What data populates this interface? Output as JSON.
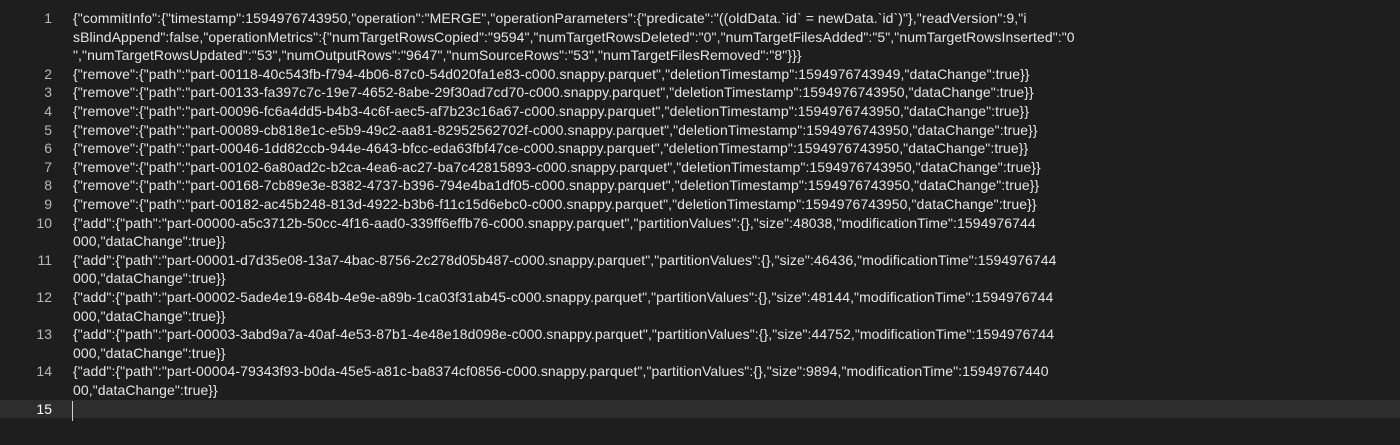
{
  "editor": {
    "lines": [
      {
        "number": "1",
        "text": [
          "{\"commitInfo\":{\"timestamp\":1594976743950,\"operation\":\"MERGE\",\"operationParameters\":{\"predicate\":\"((oldData.`id` = newData.`id`)\"},\"readVersion\":9,\"i",
          "sBlindAppend\":false,\"operationMetrics\":{\"numTargetRowsCopied\":\"9594\",\"numTargetRowsDeleted\":\"0\",\"numTargetFilesAdded\":\"5\",\"numTargetRowsInserted\":\"0",
          "\",\"numTargetRowsUpdated\":\"53\",\"numOutputRows\":\"9647\",\"numSourceRows\":\"53\",\"numTargetFilesRemoved\":\"8\"}}}"
        ]
      },
      {
        "number": "2",
        "text": [
          "{\"remove\":{\"path\":\"part-00118-40c543fb-f794-4b06-87c0-54d020fa1e83-c000.snappy.parquet\",\"deletionTimestamp\":1594976743949,\"dataChange\":true}}"
        ]
      },
      {
        "number": "3",
        "text": [
          "{\"remove\":{\"path\":\"part-00133-fa397c7c-19e7-4652-8abe-29f30ad7cd70-c000.snappy.parquet\",\"deletionTimestamp\":1594976743950,\"dataChange\":true}}"
        ]
      },
      {
        "number": "4",
        "text": [
          "{\"remove\":{\"path\":\"part-00096-fc6a4dd5-b4b3-4c6f-aec5-af7b23c16a67-c000.snappy.parquet\",\"deletionTimestamp\":1594976743950,\"dataChange\":true}}"
        ]
      },
      {
        "number": "5",
        "text": [
          "{\"remove\":{\"path\":\"part-00089-cb818e1c-e5b9-49c2-aa81-82952562702f-c000.snappy.parquet\",\"deletionTimestamp\":1594976743950,\"dataChange\":true}}"
        ]
      },
      {
        "number": "6",
        "text": [
          "{\"remove\":{\"path\":\"part-00046-1dd82ccb-944e-4643-bfcc-eda63fbf47ce-c000.snappy.parquet\",\"deletionTimestamp\":1594976743950,\"dataChange\":true}}"
        ]
      },
      {
        "number": "7",
        "text": [
          "{\"remove\":{\"path\":\"part-00102-6a80ad2c-b2ca-4ea6-ac27-ba7c42815893-c000.snappy.parquet\",\"deletionTimestamp\":1594976743950,\"dataChange\":true}}"
        ]
      },
      {
        "number": "8",
        "text": [
          "{\"remove\":{\"path\":\"part-00168-7cb89e3e-8382-4737-b396-794e4ba1df05-c000.snappy.parquet\",\"deletionTimestamp\":1594976743950,\"dataChange\":true}}"
        ]
      },
      {
        "number": "9",
        "text": [
          "{\"remove\":{\"path\":\"part-00182-ac45b248-813d-4922-b3b6-f11c15d6ebc0-c000.snappy.parquet\",\"deletionTimestamp\":1594976743950,\"dataChange\":true}}"
        ]
      },
      {
        "number": "10",
        "text": [
          "{\"add\":{\"path\":\"part-00000-a5c3712b-50cc-4f16-aad0-339ff6effb76-c000.snappy.parquet\",\"partitionValues\":{},\"size\":48038,\"modificationTime\":1594976744",
          "000,\"dataChange\":true}}"
        ]
      },
      {
        "number": "11",
        "text": [
          "{\"add\":{\"path\":\"part-00001-d7d35e08-13a7-4bac-8756-2c278d05b487-c000.snappy.parquet\",\"partitionValues\":{},\"size\":46436,\"modificationTime\":1594976744",
          "000,\"dataChange\":true}}"
        ]
      },
      {
        "number": "12",
        "text": [
          "{\"add\":{\"path\":\"part-00002-5ade4e19-684b-4e9e-a89b-1ca03f31ab45-c000.snappy.parquet\",\"partitionValues\":{},\"size\":48144,\"modificationTime\":1594976744",
          "000,\"dataChange\":true}}"
        ]
      },
      {
        "number": "13",
        "text": [
          "{\"add\":{\"path\":\"part-00003-3abd9a7a-40af-4e53-87b1-4e48e18d098e-c000.snappy.parquet\",\"partitionValues\":{},\"size\":44752,\"modificationTime\":1594976744",
          "000,\"dataChange\":true}}"
        ]
      },
      {
        "number": "14",
        "text": [
          "{\"add\":{\"path\":\"part-00004-79343f93-b0da-45e5-a81c-ba8374cf0856-c000.snappy.parquet\",\"partitionValues\":{},\"size\":9894,\"modificationTime\":15949767440",
          "00,\"dataChange\":true}}"
        ]
      },
      {
        "number": "15",
        "text": [
          ""
        ]
      }
    ],
    "current_line": "15"
  },
  "theme": {
    "background": "#1e1e1e",
    "text": "#e6e6e6",
    "gutter_text": "#b8b8b8",
    "current_line": "#2d2d2d"
  }
}
